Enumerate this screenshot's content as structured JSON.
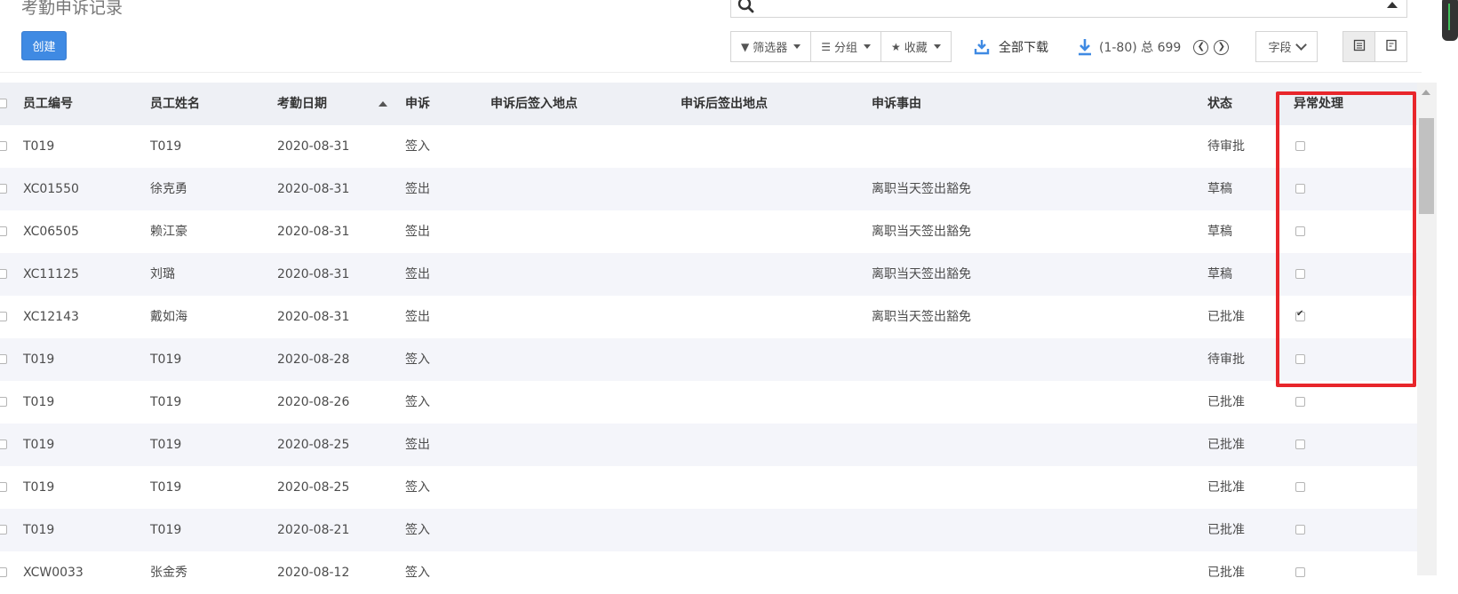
{
  "title": "考勤申诉记录",
  "create_label": "创建",
  "search": {
    "value": "",
    "placeholder": ""
  },
  "toolbar": {
    "filter_label": "筛选器",
    "group_label": "分组",
    "favorite_label": "收藏",
    "download_all_label": "全部下载",
    "pager_text": "(1-80) 总 699",
    "fields_label": "字段"
  },
  "colors": {
    "primary": "#3f8ae3",
    "highlight": "#e8262b",
    "header_bg": "#eef0f5",
    "stripe_bg": "#f4f5fa"
  },
  "table": {
    "columns": [
      "员工编号",
      "员工姓名",
      "考勤日期",
      "申诉",
      "申诉后签入地点",
      "申诉后签出地点",
      "申诉事由",
      "状态",
      "异常处理"
    ],
    "rows": [
      {
        "id": "T019",
        "name": "T019",
        "date": "2020-08-31",
        "type": "签入",
        "in_loc": "",
        "out_loc": "",
        "reason": "",
        "status": "待审批",
        "exception": false
      },
      {
        "id": "XC01550",
        "name": "徐克勇",
        "date": "2020-08-31",
        "type": "签出",
        "in_loc": "",
        "out_loc": "",
        "reason": "离职当天签出豁免",
        "status": "草稿",
        "exception": false
      },
      {
        "id": "XC06505",
        "name": "赖江豪",
        "date": "2020-08-31",
        "type": "签出",
        "in_loc": "",
        "out_loc": "",
        "reason": "离职当天签出豁免",
        "status": "草稿",
        "exception": false
      },
      {
        "id": "XC11125",
        "name": "刘璐",
        "date": "2020-08-31",
        "type": "签出",
        "in_loc": "",
        "out_loc": "",
        "reason": "离职当天签出豁免",
        "status": "草稿",
        "exception": false
      },
      {
        "id": "XC12143",
        "name": "戴如海",
        "date": "2020-08-31",
        "type": "签出",
        "in_loc": "",
        "out_loc": "",
        "reason": "离职当天签出豁免",
        "status": "已批准",
        "exception": true
      },
      {
        "id": "T019",
        "name": "T019",
        "date": "2020-08-28",
        "type": "签入",
        "in_loc": "",
        "out_loc": "",
        "reason": "",
        "status": "待审批",
        "exception": false
      },
      {
        "id": "T019",
        "name": "T019",
        "date": "2020-08-26",
        "type": "签入",
        "in_loc": "",
        "out_loc": "",
        "reason": "",
        "status": "已批准",
        "exception": false
      },
      {
        "id": "T019",
        "name": "T019",
        "date": "2020-08-25",
        "type": "签出",
        "in_loc": "",
        "out_loc": "",
        "reason": "",
        "status": "已批准",
        "exception": false
      },
      {
        "id": "T019",
        "name": "T019",
        "date": "2020-08-25",
        "type": "签入",
        "in_loc": "",
        "out_loc": "",
        "reason": "",
        "status": "已批准",
        "exception": false
      },
      {
        "id": "T019",
        "name": "T019",
        "date": "2020-08-21",
        "type": "签入",
        "in_loc": "",
        "out_loc": "",
        "reason": "",
        "status": "已批准",
        "exception": false
      },
      {
        "id": "XCW0033",
        "name": "张金秀",
        "date": "2020-08-12",
        "type": "签入",
        "in_loc": "",
        "out_loc": "",
        "reason": "",
        "status": "已批准",
        "exception": false
      }
    ]
  }
}
